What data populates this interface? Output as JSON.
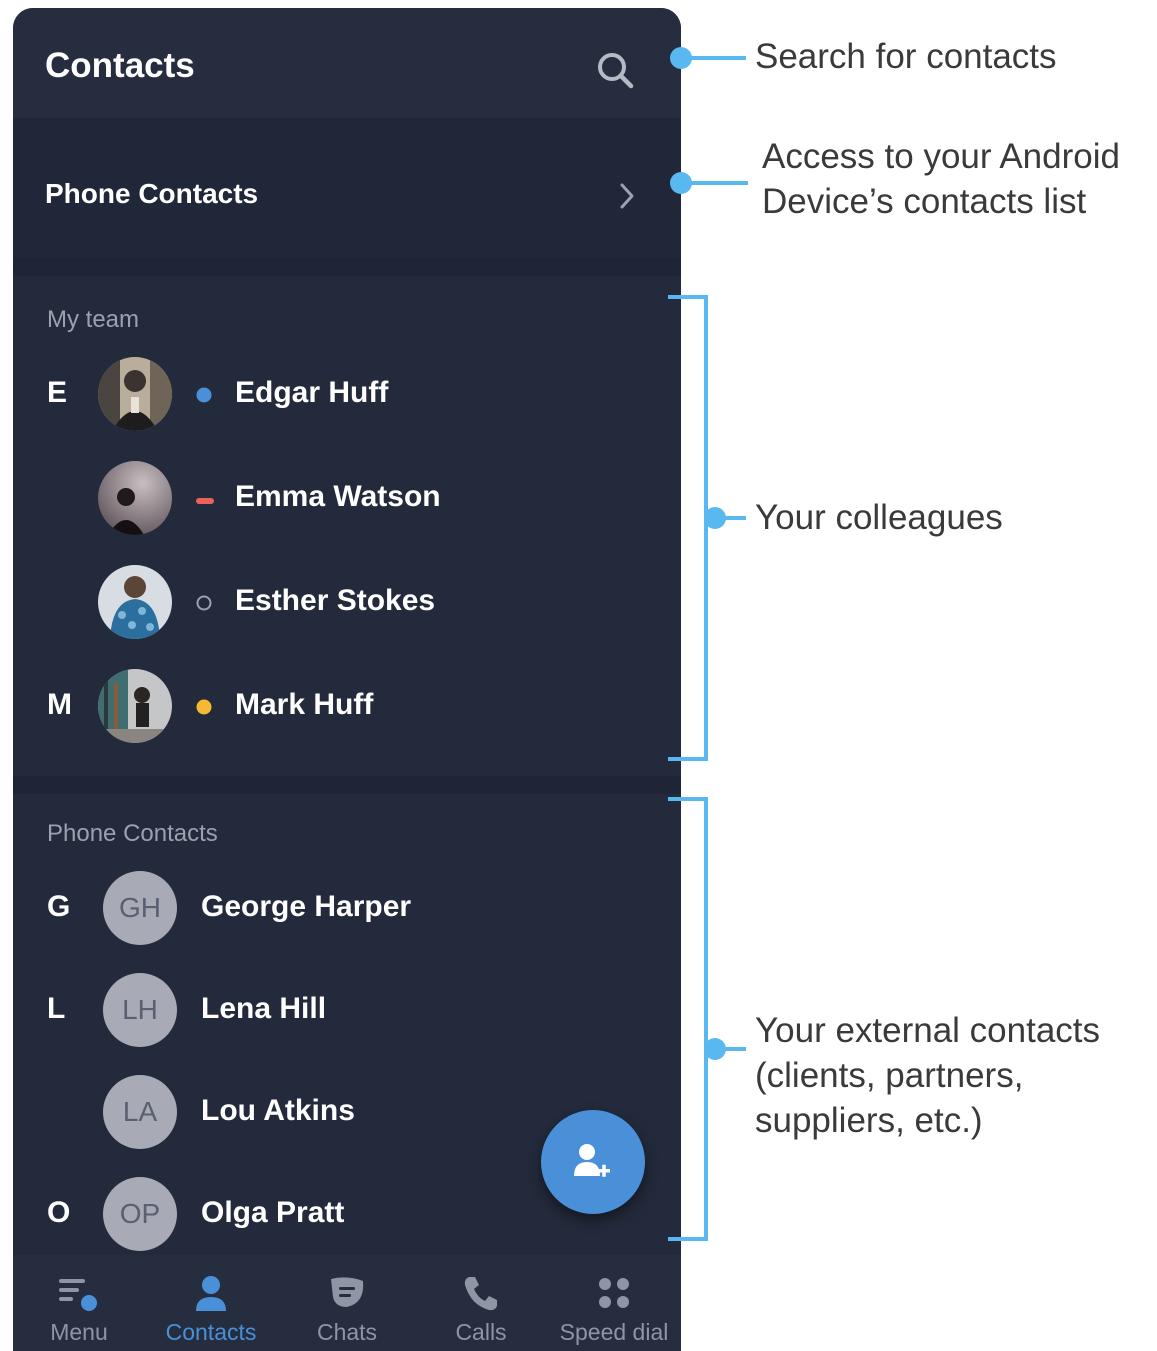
{
  "header": {
    "title": "Contacts",
    "search_icon": "search-icon"
  },
  "phone_contacts_link": {
    "label": "Phone Contacts"
  },
  "sections": {
    "team": {
      "title": "My team",
      "contacts": [
        {
          "letter": "E",
          "name": "Edgar Huff",
          "status": "available",
          "status_color": "#4a90d9"
        },
        {
          "letter": "",
          "name": "Emma Watson",
          "status": "do-not-disturb",
          "status_color": "#e8645a"
        },
        {
          "letter": "",
          "name": "Esther Stokes",
          "status": "offline",
          "status_color": "#9aa1af"
        },
        {
          "letter": "M",
          "name": "Mark Huff",
          "status": "away",
          "status_color": "#f5b936"
        }
      ]
    },
    "phone": {
      "title": "Phone Contacts",
      "contacts": [
        {
          "letter": "G",
          "initials": "GH",
          "name": "George Harper"
        },
        {
          "letter": "L",
          "initials": "LH",
          "name": "Lena Hill"
        },
        {
          "letter": "",
          "initials": "LA",
          "name": "Lou Atkins"
        },
        {
          "letter": "O",
          "initials": "OP",
          "name": "Olga Pratt"
        }
      ]
    }
  },
  "fab": {
    "icon": "add-contact-icon"
  },
  "bottom_nav": [
    {
      "label": "Menu",
      "icon": "menu-icon",
      "active": false
    },
    {
      "label": "Contacts",
      "icon": "contacts-icon",
      "active": true
    },
    {
      "label": "Chats",
      "icon": "chats-icon",
      "active": false
    },
    {
      "label": "Calls",
      "icon": "calls-icon",
      "active": false
    },
    {
      "label": "Speed dial",
      "icon": "speed-dial-icon",
      "active": false
    }
  ],
  "annotations": {
    "search": "Search for contacts",
    "phone_contacts_line1": "Access to your Android",
    "phone_contacts_line2": "Device’s contacts list",
    "colleagues": "Your colleagues",
    "external_line1": "Your external contacts",
    "external_line2": "(clients, partners,",
    "external_line3": "suppliers, etc.)"
  },
  "colors": {
    "accent": "#4a90d9",
    "annotation": "#5ab8f0",
    "background": "#232a3b"
  }
}
